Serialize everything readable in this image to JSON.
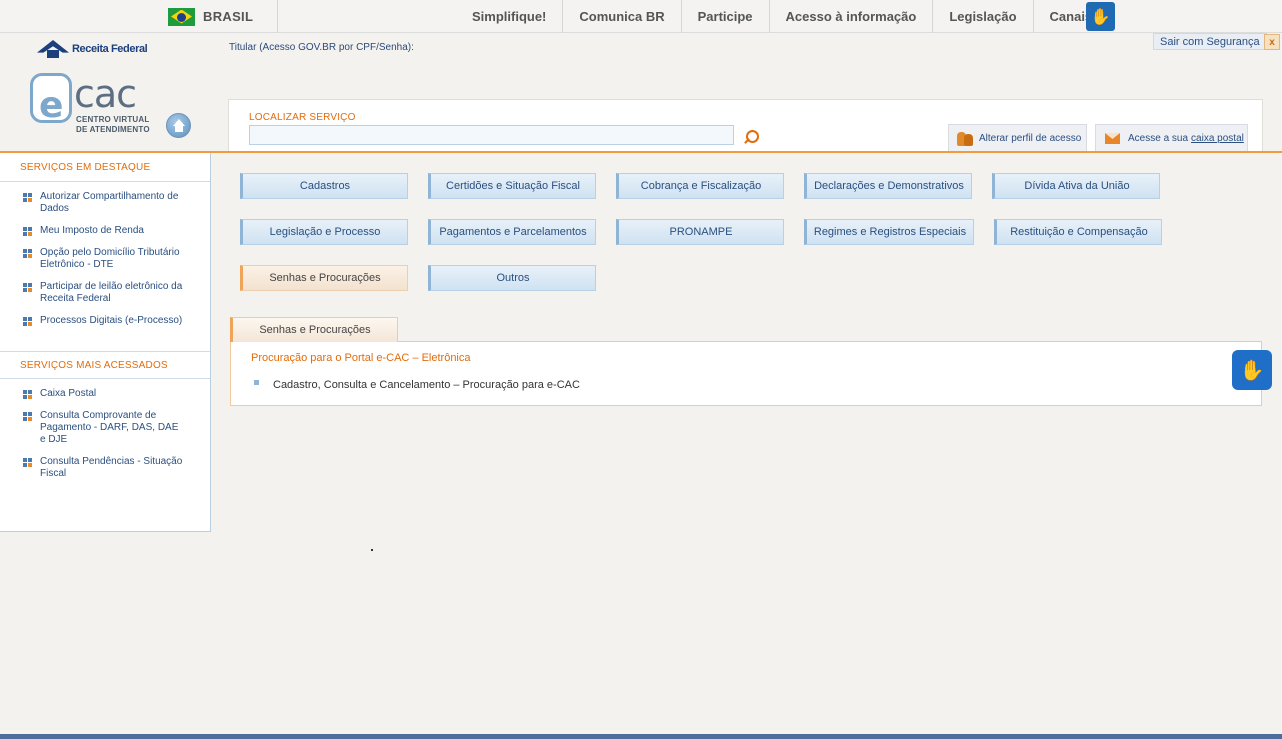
{
  "govbar": {
    "country": "BRASIL",
    "links": [
      "Simplifique!",
      "Comunica BR",
      "Participe",
      "Acesso à informação",
      "Legislação",
      "Canais"
    ],
    "accessibility_icon": "hands-sign-language-icon"
  },
  "header": {
    "receita_logo": "Receita Federal",
    "titular": "Titular (Acesso GOV.BR por CPF/Senha):",
    "logout": "Sair com Segurança",
    "logout_close": "x",
    "ecac_e": "e",
    "ecac_cac": "cac",
    "ecac_subtitle_1": "CENTRO VIRTUAL",
    "ecac_subtitle_2": "DE ATENDIMENTO"
  },
  "search": {
    "label": "LOCALIZAR SERVIÇO",
    "value": "",
    "profile_button": "Alterar perfil de acesso",
    "mail_prefix": "Acesse a sua",
    "mail_link": "caixa postal"
  },
  "sidebar": {
    "featured_title": "SERVIÇOS EM DESTAQUE",
    "featured": [
      "Autorizar Compartilhamento de Dados",
      "Meu Imposto de Renda",
      "Opção pelo Domicílio Tributário Eletrônico - DTE",
      "Participar de leilão eletrônico da Receita Federal",
      "Processos Digitais (e-Processo)"
    ],
    "most_accessed_title": "SERVIÇOS MAIS ACESSADOS",
    "most_accessed": [
      "Caixa Postal",
      "Consulta Comprovante de Pagamento - DARF, DAS, DAE e DJE",
      "Consulta Pendências - Situação Fiscal"
    ]
  },
  "categories": [
    "Cadastros",
    "Certidões e Situação Fiscal",
    "Cobrança e Fiscalização",
    "Declarações e Demonstrativos",
    "Dívida Ativa da União",
    "Legislação e Processo",
    "Pagamentos e Parcelamentos",
    "PRONAMPE",
    "Regimes e Registros Especiais",
    "Restituição e Compensação",
    "Senhas e Procurações",
    "Outros"
  ],
  "active_category": "Senhas e Procurações",
  "panel": {
    "tab_label": "Senhas e Procurações",
    "group_title": "Procuração para o Portal e-CAC – Eletrônica",
    "items": [
      "Cadastro, Consulta e Cancelamento – Procuração para e-CAC"
    ]
  },
  "colors": {
    "accent_orange": "#e36c0a",
    "link_blue": "#2a4f80",
    "vlibras_blue": "#1f6fc9"
  }
}
